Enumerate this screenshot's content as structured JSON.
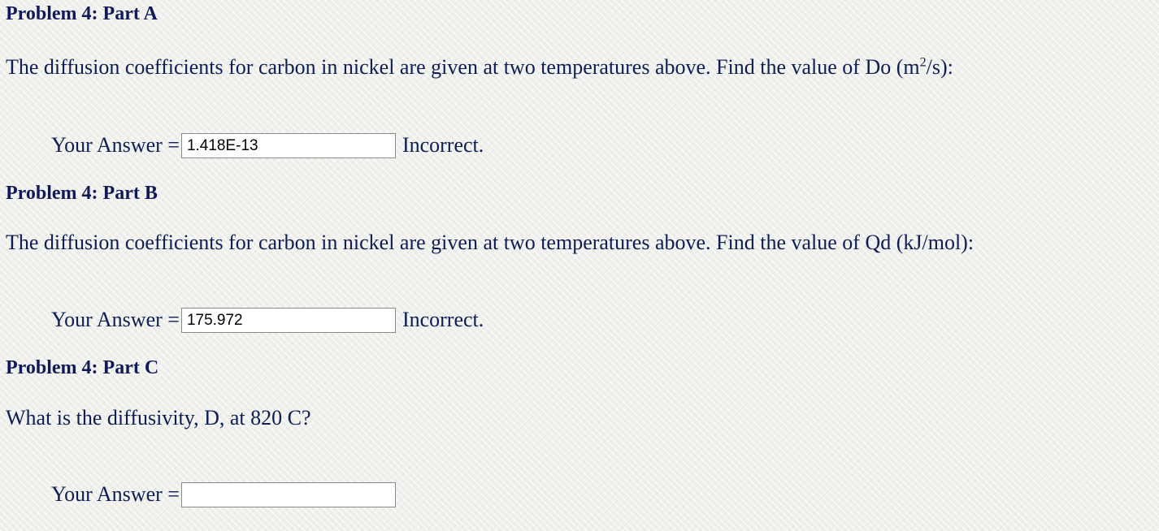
{
  "partA": {
    "heading": "Problem 4: Part A",
    "question_text": "The diffusion coefficients for carbon in nickel are given at two temperatures above. Find the value of Do (m",
    "question_sup": "2",
    "question_tail": "/s):",
    "answer_label": "Your Answer =",
    "answer_value": "1.418E-13",
    "feedback": "Incorrect."
  },
  "partB": {
    "heading": "Problem 4: Part B",
    "question_text": "The diffusion coefficients for carbon in nickel are given at two temperatures above. Find the value of Qd (kJ/mol):",
    "answer_label": "Your Answer =",
    "answer_value": "175.972",
    "feedback": "Incorrect."
  },
  "partC": {
    "heading": "Problem 4: Part C",
    "question_text": "What is the diffusivity, D, at 820 C?",
    "answer_label": "Your Answer =",
    "answer_value": ""
  },
  "colors": {
    "text": "#0d1d55",
    "heading": "#101a5a",
    "background": "#efefec"
  }
}
